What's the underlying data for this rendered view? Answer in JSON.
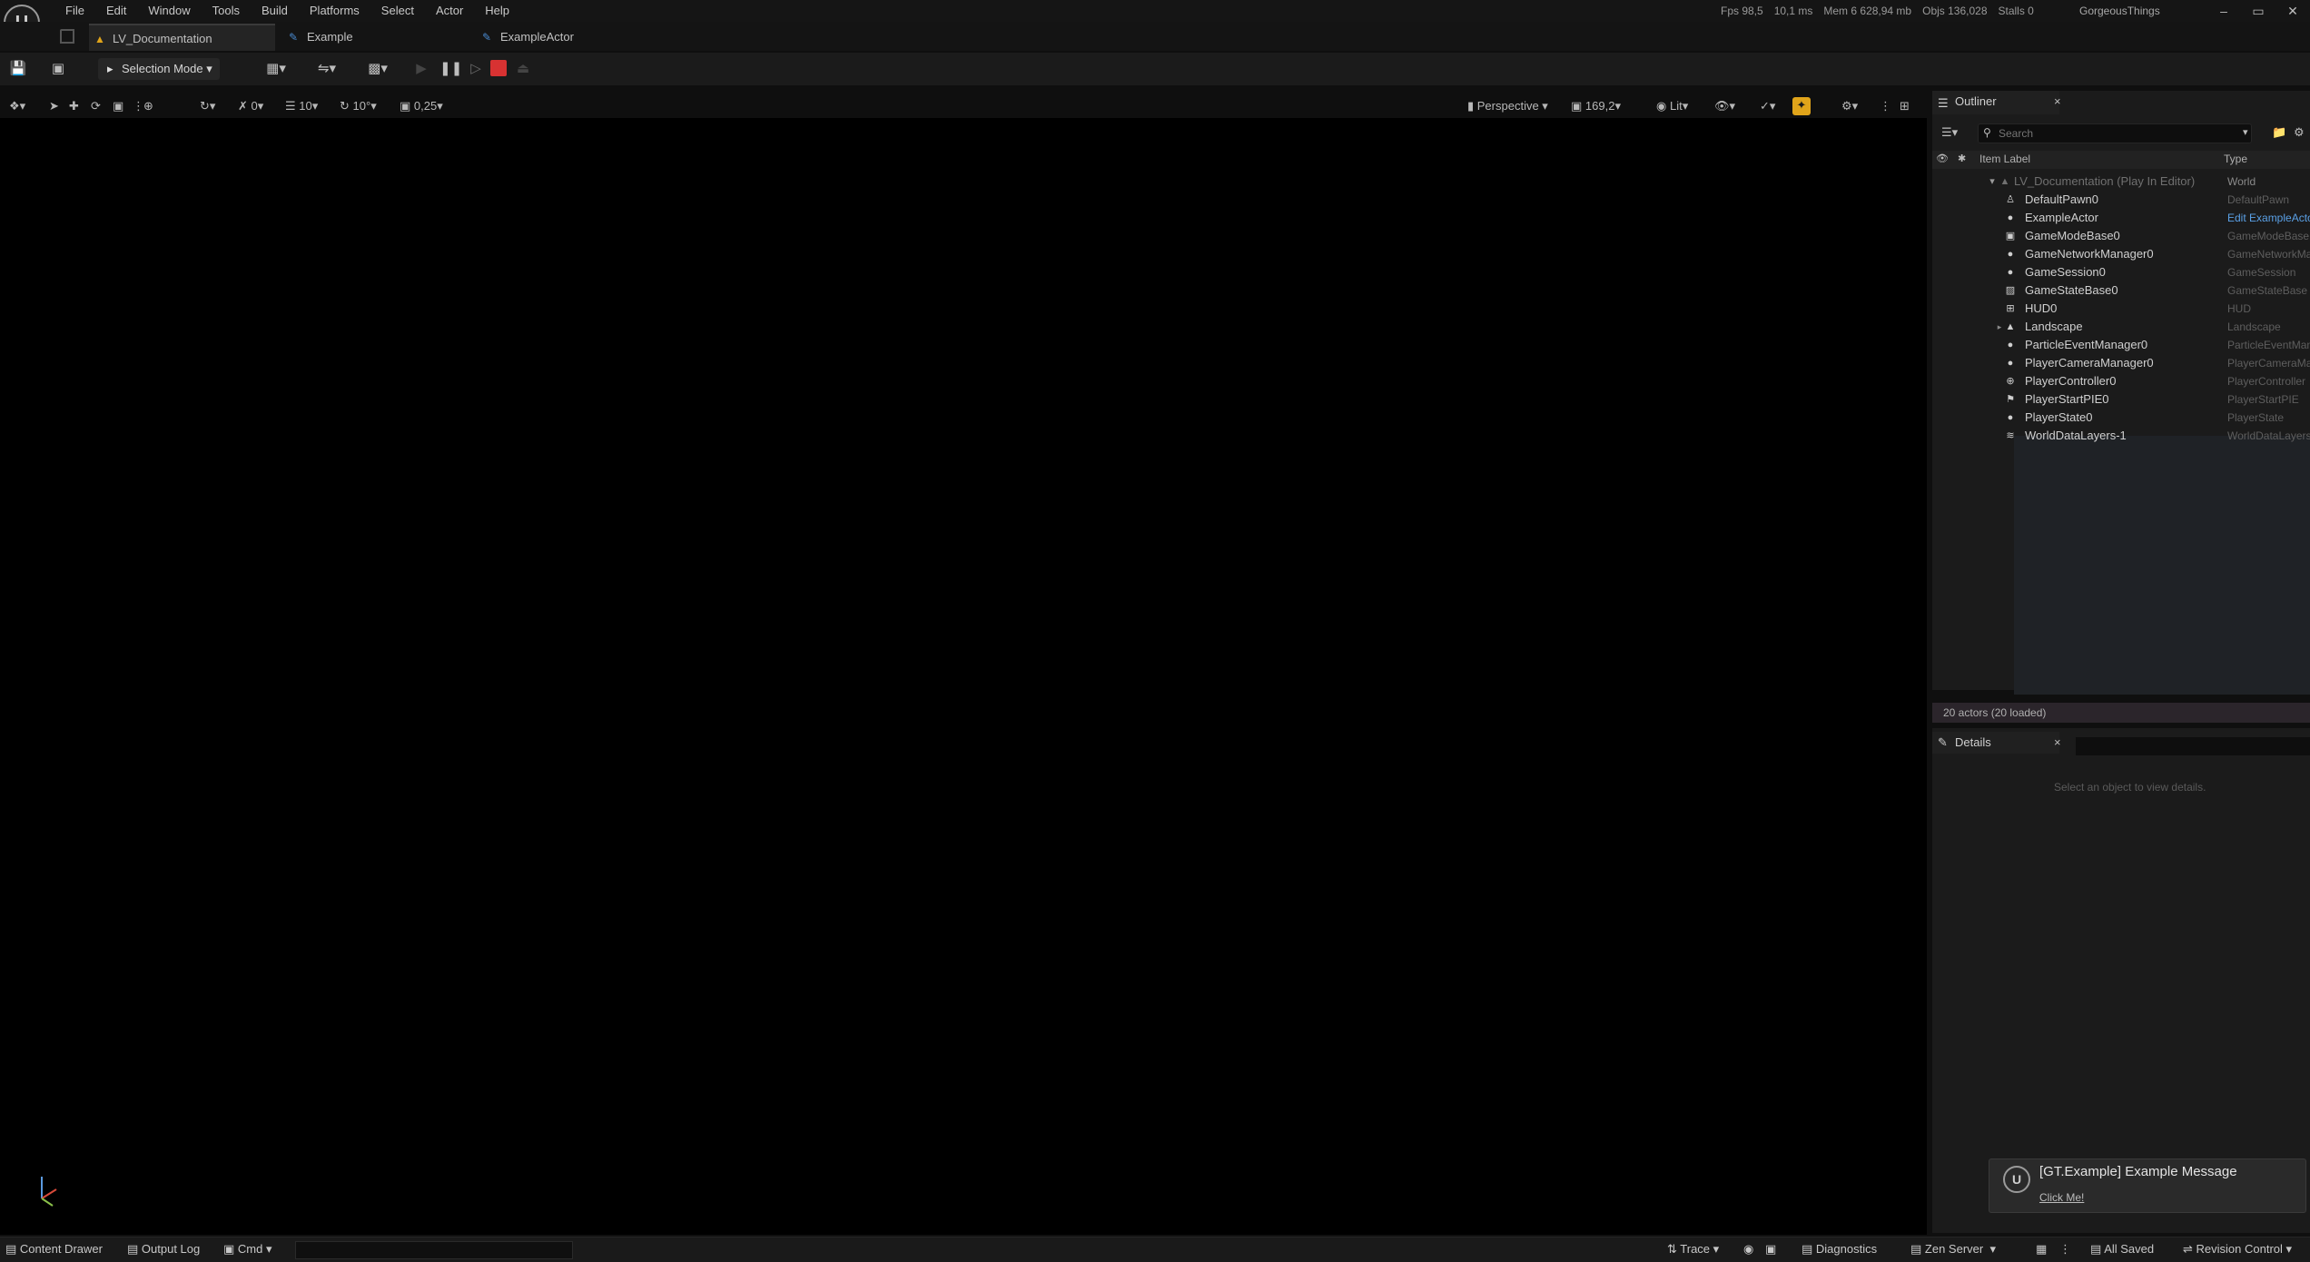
{
  "app": {
    "logo_letter": "U"
  },
  "menu": [
    "File",
    "Edit",
    "Window",
    "Tools",
    "Build",
    "Platforms",
    "Select",
    "Actor",
    "Help"
  ],
  "stats": {
    "fps": "Fps 98,5",
    "ms": "10,1 ms",
    "mem": "Mem 6 628,94 mb",
    "objs": "Objs 136,028",
    "stalls": "Stalls 0"
  },
  "project_name": "GorgeousThings",
  "window_controls": [
    "–",
    "▭",
    "✕"
  ],
  "tabs": [
    {
      "label": "LV_Documentation",
      "active": true
    },
    {
      "label": "Example",
      "active": false
    },
    {
      "label": "ExampleActor",
      "active": false
    }
  ],
  "toolbar": {
    "selection_mode": "Selection Mode",
    "play_state": "paused"
  },
  "viewport_toolbar": {
    "translate_snap": "10",
    "rotate_snap": "10°",
    "scale_snap": "0,25",
    "translate_label": "0",
    "view_mode": "Perspective",
    "camera_speed": "169,2",
    "lighting": "Lit"
  },
  "outliner": {
    "title": "Outliner",
    "close": "×",
    "search_placeholder": "Search",
    "col_item_label": "Item Label",
    "col_type": "Type",
    "world_row": {
      "label": "LV_Documentation (Play In Editor)",
      "type": "World"
    },
    "rows": [
      {
        "label": "DefaultPawn0",
        "type": "DefaultPawn",
        "icon": "pawn-icon",
        "glyph": "♙"
      },
      {
        "label": "ExampleActor",
        "type": "Edit ExampleActor",
        "icon": "actor-icon",
        "glyph": "●",
        "type_is_link": true
      },
      {
        "label": "GameModeBase0",
        "type": "GameModeBase",
        "icon": "game-mode-icon",
        "glyph": "▣"
      },
      {
        "label": "GameNetworkManager0",
        "type": "GameNetworkManager",
        "icon": "actor-icon",
        "glyph": "●"
      },
      {
        "label": "GameSession0",
        "type": "GameSession",
        "icon": "actor-icon",
        "glyph": "●"
      },
      {
        "label": "GameStateBase0",
        "type": "GameStateBase",
        "icon": "game-state-icon",
        "glyph": "▨"
      },
      {
        "label": "HUD0",
        "type": "HUD",
        "icon": "hud-icon",
        "glyph": "⊞"
      },
      {
        "label": "Landscape",
        "type": "Landscape",
        "icon": "landscape-icon",
        "glyph": "▲"
      },
      {
        "label": "ParticleEventManager0",
        "type": "ParticleEventManager",
        "icon": "actor-icon",
        "glyph": "●"
      },
      {
        "label": "PlayerCameraManager0",
        "type": "PlayerCameraManager",
        "icon": "actor-icon",
        "glyph": "●"
      },
      {
        "label": "PlayerController0",
        "type": "PlayerController",
        "icon": "gamepad-icon",
        "glyph": "⊕"
      },
      {
        "label": "PlayerStartPIE0",
        "type": "PlayerStartPIE",
        "icon": "player-start-icon",
        "glyph": "⚑"
      },
      {
        "label": "PlayerState0",
        "type": "PlayerState",
        "icon": "actor-icon",
        "glyph": "●"
      },
      {
        "label": "WorldDataLayers-1",
        "type": "WorldDataLayers",
        "icon": "layers-icon",
        "glyph": "≋"
      }
    ],
    "actor_count": "20 actors (20 loaded)"
  },
  "details": {
    "title": "Details",
    "close": "×",
    "hint": "Select an object to view details."
  },
  "toast": {
    "message": "[GT.Example] Example Message",
    "link": "Click Me!"
  },
  "statusbar": {
    "content_drawer": "Content Drawer",
    "output_log": "Output Log",
    "cmd": "Cmd",
    "trace": "Trace",
    "diagnostics": "Diagnostics",
    "zen_server": "Zen Server",
    "all_saved": "All Saved",
    "revision_control": "Revision Control"
  },
  "colors": {
    "stop_button": "#d83232",
    "highlight_button": "#e0a41a",
    "link": "#5aa0e6",
    "viewport_bg": "#000000"
  }
}
